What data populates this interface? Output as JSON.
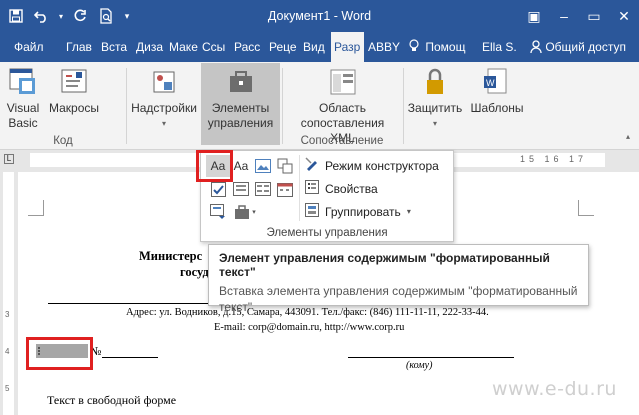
{
  "window": {
    "title": "Документ1 - Word",
    "quick_access": [
      "save-icon",
      "undo-icon",
      "redo-icon",
      "print-preview-icon",
      "customize-qat-icon"
    ],
    "controls": {
      "minimize": "–",
      "restore": "▭",
      "close": "✕",
      "ribbon_options": "▣"
    }
  },
  "tabs": [
    {
      "label": "Файл"
    },
    {
      "label": "Глав"
    },
    {
      "label": "Вста"
    },
    {
      "label": "Диза"
    },
    {
      "label": "Маке"
    },
    {
      "label": "Ссы"
    },
    {
      "label": "Расс"
    },
    {
      "label": "Реце"
    },
    {
      "label": "Вид"
    },
    {
      "label": "Разр",
      "active": true
    },
    {
      "label": "ABBY"
    }
  ],
  "tabs_right": {
    "tell_me": "Помощ",
    "user": "Ella S.",
    "share": "Общий доступ"
  },
  "ribbon": {
    "visual_basic": "Visual\nBasic",
    "macros": "Макросы",
    "group_code": "Код",
    "addins": "Надстройки",
    "controls": "Элементы управления",
    "xml_pane": "Область сопоставления XML",
    "group_mapping": "Сопоставление",
    "protect": "Защитить",
    "templates": "Шаблоны"
  },
  "dropdown": {
    "rich_text_glyph": "Aa",
    "plain_text_glyph": "Aa",
    "design_mode": "Режим конструктора",
    "properties": "Свойства",
    "group": "Группировать",
    "footer": "Элементы управления"
  },
  "tooltip": {
    "title": "Элемент управления содержимым \"форматированный текст\"",
    "description": "Вставка элемента управления содержимым \"форматированный текст\"."
  },
  "document": {
    "heading_left": "Министерс",
    "heading_left2": "госуд",
    "address": "Адрес: ул. Водников, д.15, Самара, 443091. Тел./факс: (846) 111-11-11, 222-33-44.",
    "email": "E-mail: corp@domain.ru, http://www.corp.ru",
    "number_sign": "№",
    "to_whom": "(кому)",
    "free_text": "Текст в свободной форме"
  },
  "ruler": {
    "numbers": "15 16 17"
  },
  "vruler": [
    "3",
    "4",
    "5"
  ],
  "watermark": "www.e-du.ru",
  "colors": {
    "word_blue": "#2b579a",
    "highlight_red": "#e02020"
  }
}
